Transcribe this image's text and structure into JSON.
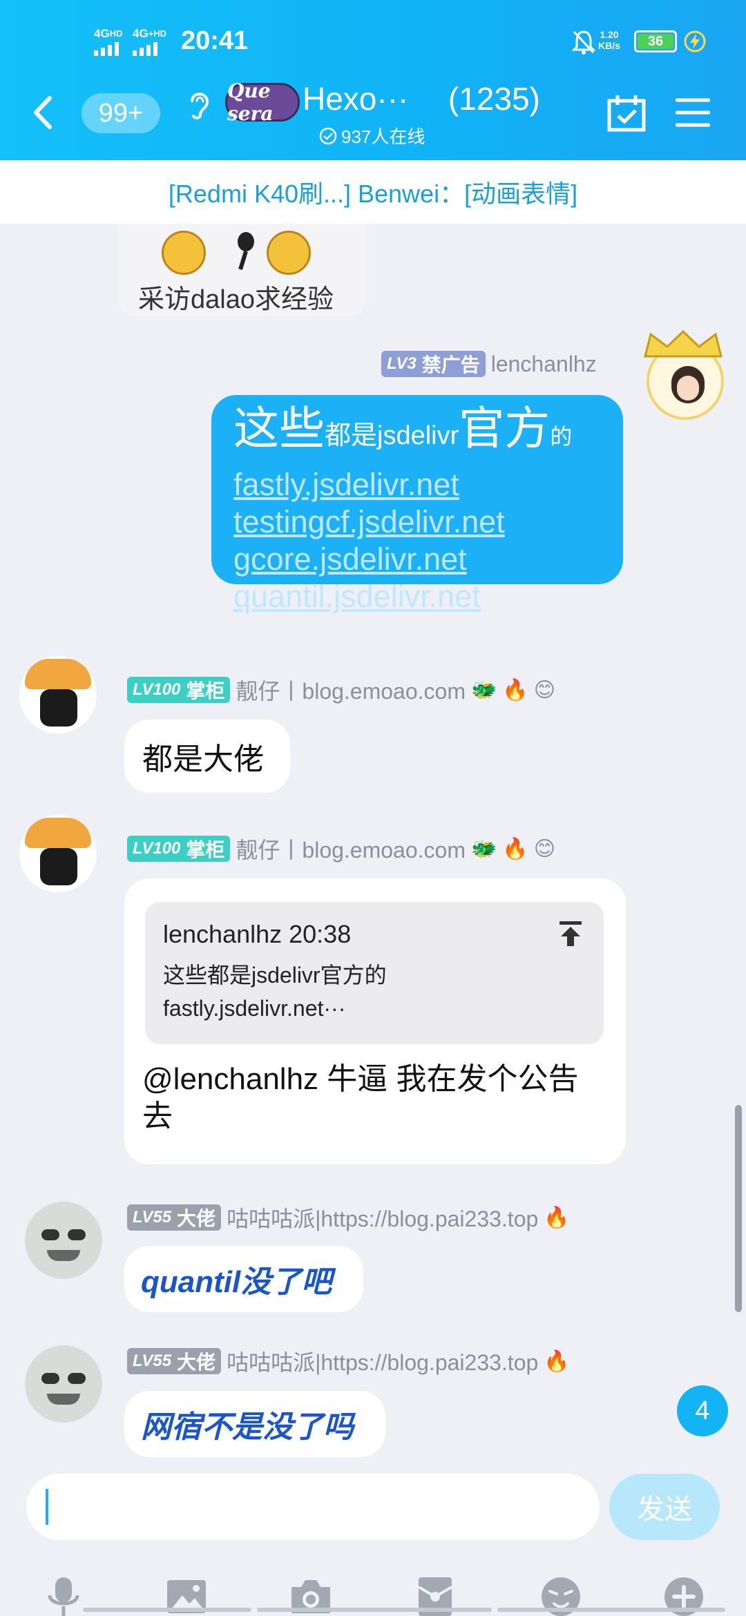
{
  "status_bar": {
    "network_1": "4G",
    "network_1_sup": "HD",
    "network_2": "4G",
    "network_2_sup": "+HD",
    "time": "20:41",
    "speed_value": "1.20",
    "speed_unit": "KB/s",
    "battery": "36"
  },
  "header": {
    "unread_count": "99+",
    "group_logo_text": "Que sera",
    "group_name": "Hexo···",
    "member_count": "(1235)",
    "online_text": "937人在线",
    "icons": [
      "back-arrow-icon",
      "ear-icon",
      "calendar-check-icon",
      "menu-icon",
      "check-circle-icon"
    ]
  },
  "pinned": {
    "text": "[Redmi K40刷...] Benwei：[动画表情]"
  },
  "top_message": {
    "sticker_caption": "采访dalao求经验"
  },
  "messages": {
    "m1": {
      "level": "LV3",
      "title": "禁广告",
      "sender": "lenchanlhz",
      "text_big_1": "这些",
      "text_small_1": "都是jsdelivr",
      "text_big_2": "官方",
      "text_small_2": "的",
      "links": [
        "fastly.jsdelivr.net",
        "testingcf.jsdelivr.net",
        "gcore.jsdelivr.net",
        "quantil.jsdelivr.net"
      ]
    },
    "m2": {
      "level": "LV100",
      "title": "掌柜",
      "sender": "靓仔丨blog.emoao.com",
      "text": "都是大佬"
    },
    "m3": {
      "level": "LV100",
      "title": "掌柜",
      "sender": "靓仔丨blog.emoao.com",
      "quote_header": "lenchanlhz 20:38",
      "quote_line_1": "这些都是jsdelivr官方的",
      "quote_line_2": "fastly.jsdelivr.net···",
      "text": "@lenchanlhz 牛逼 我在发个公告去"
    },
    "m4": {
      "level": "LV55",
      "title": "大佬",
      "sender": "咕咕咕派|https://blog.pai233.top",
      "text": "quantil没了吧"
    },
    "m5": {
      "level": "LV55",
      "title": "大佬",
      "sender": "咕咕咕派|https://blog.pai233.top",
      "text": "网宿不是没了吗"
    }
  },
  "unread_fab": "4",
  "input": {
    "placeholder": "",
    "send_label": "发送",
    "tools": [
      "microphone-icon",
      "image-icon",
      "camera-icon",
      "red-packet-icon",
      "emoji-icon",
      "plus-icon"
    ]
  },
  "colors": {
    "header": "#14c0f8",
    "accent": "#1cb0f6",
    "badge_lv3": "#8e9fd8",
    "badge_lv100": "#3ccfc4",
    "badge_lv55": "#9aa0ac"
  }
}
